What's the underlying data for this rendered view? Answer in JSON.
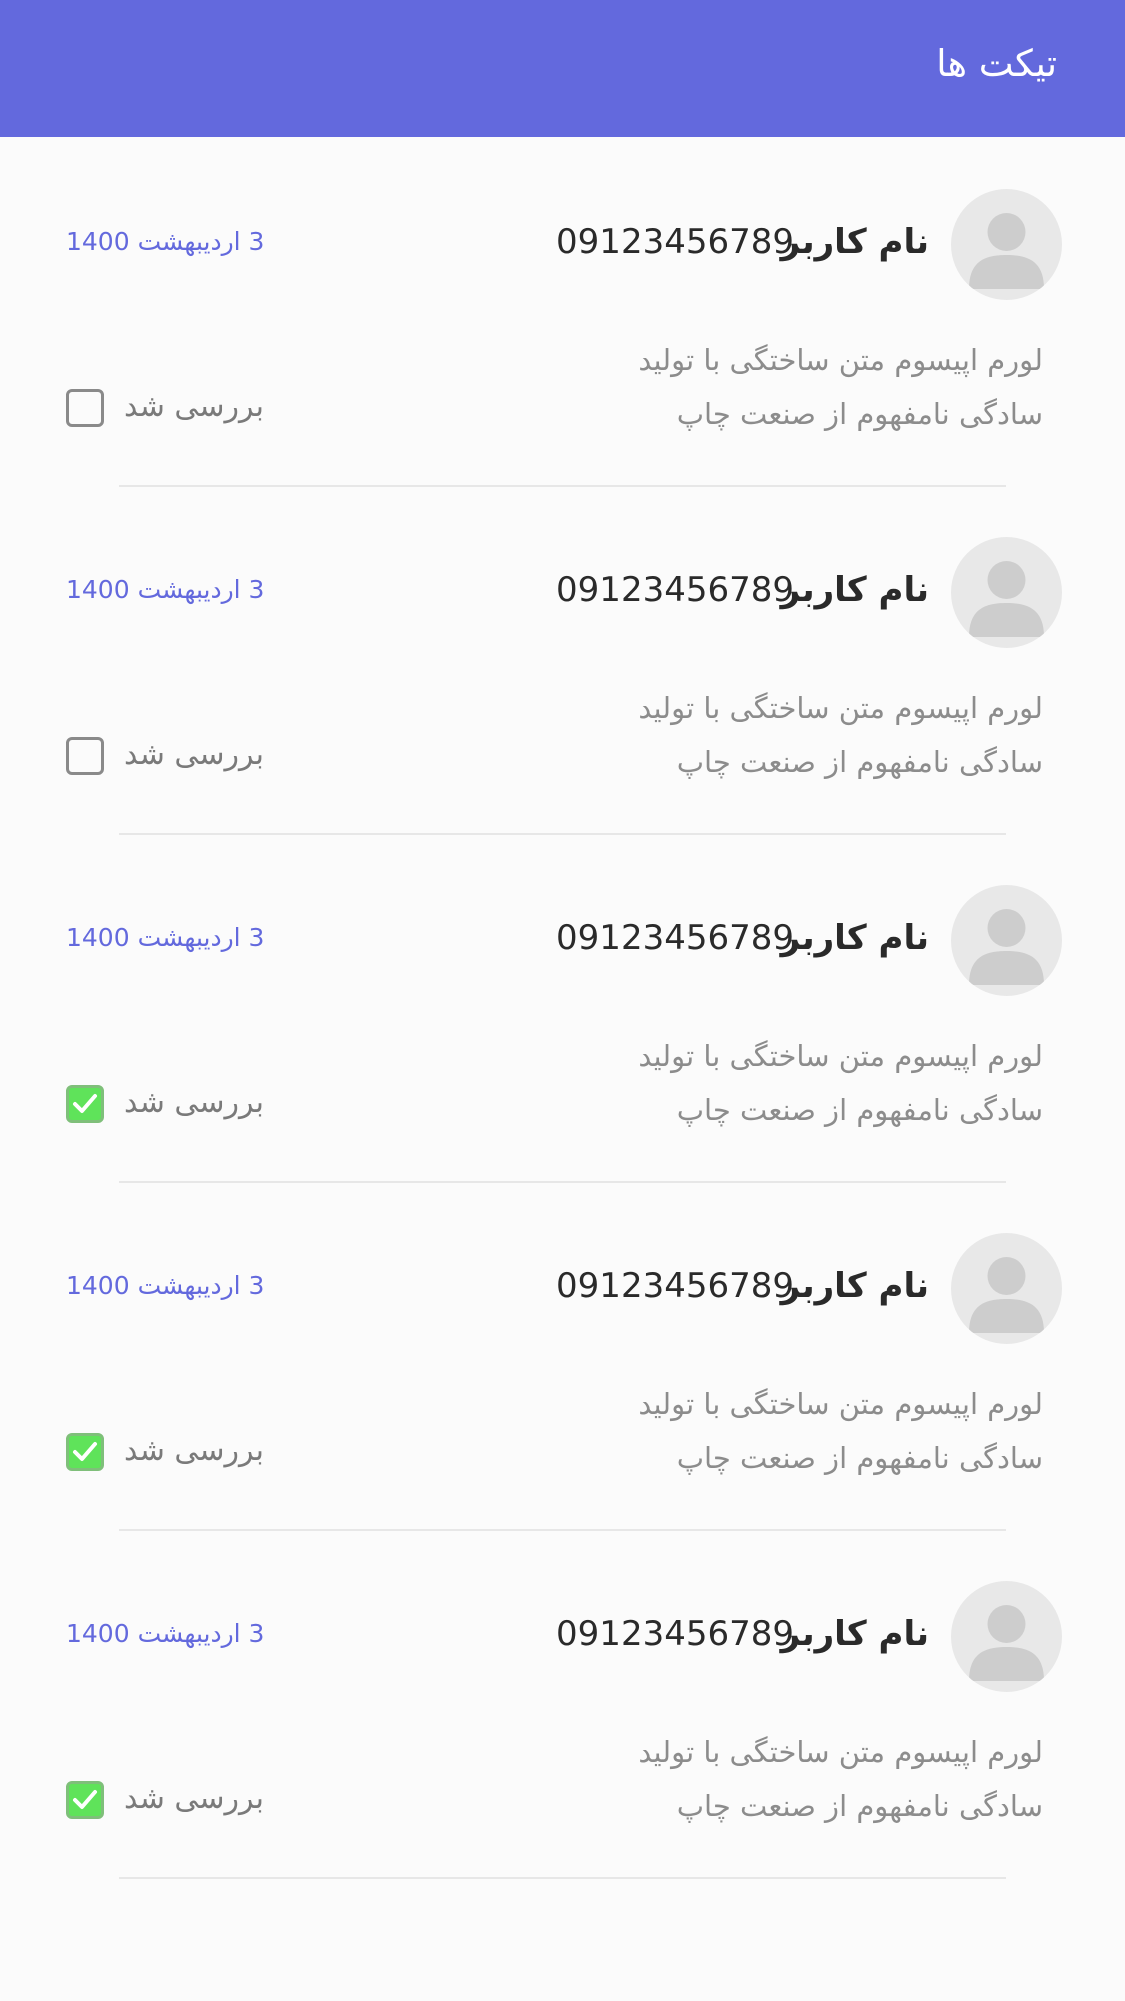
{
  "header": {
    "title": "تیکت ها",
    "background": "#6369dd"
  },
  "colors": {
    "accent": "#6369dd",
    "checked": "#5fe35a"
  },
  "tickets": [
    {
      "name": "نام کاربر",
      "phone": "09123456789",
      "date": "3 اردیبهشت 1400",
      "message_line1": "لورم اپیسوم متن ساختگی با تولید",
      "message_line2": "سادگی نامفهوم از صنعت چاپ",
      "reviewed_label": "بررسی شد",
      "reviewed": false,
      "avatar_icon": "user-placeholder-icon"
    },
    {
      "name": "نام کاربر",
      "phone": "09123456789",
      "date": "3 اردیبهشت 1400",
      "message_line1": "لورم اپیسوم متن ساختگی با تولید",
      "message_line2": "سادگی نامفهوم از صنعت چاپ",
      "reviewed_label": "بررسی شد",
      "reviewed": false,
      "avatar_icon": "user-placeholder-icon"
    },
    {
      "name": "نام کاربر",
      "phone": "09123456789",
      "date": "3 اردیبهشت 1400",
      "message_line1": "لورم اپیسوم متن ساختگی با تولید",
      "message_line2": "سادگی نامفهوم از صنعت چاپ",
      "reviewed_label": "بررسی شد",
      "reviewed": true,
      "avatar_icon": "user-placeholder-icon"
    },
    {
      "name": "نام کاربر",
      "phone": "09123456789",
      "date": "3 اردیبهشت 1400",
      "message_line1": "لورم اپیسوم متن ساختگی با تولید",
      "message_line2": "سادگی نامفهوم از صنعت چاپ",
      "reviewed_label": "بررسی شد",
      "reviewed": true,
      "avatar_icon": "user-placeholder-icon"
    },
    {
      "name": "نام کاربر",
      "phone": "09123456789",
      "date": "3 اردیبهشت 1400",
      "message_line1": "لورم اپیسوم متن ساختگی با تولید",
      "message_line2": "سادگی نامفهوم از صنعت چاپ",
      "reviewed_label": "بررسی شد",
      "reviewed": true,
      "avatar_icon": "user-placeholder-icon"
    }
  ]
}
